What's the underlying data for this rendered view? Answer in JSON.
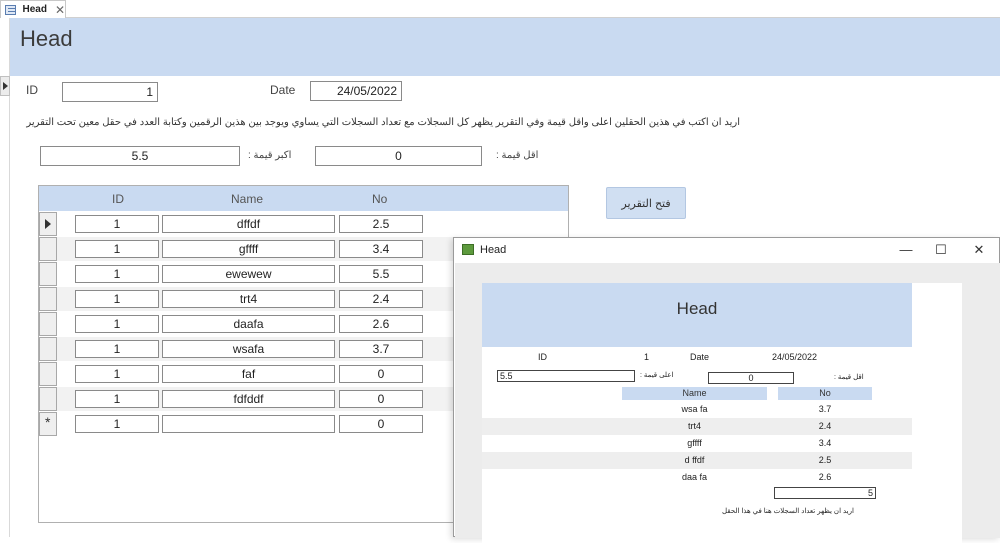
{
  "tab": {
    "label": "Head",
    "close": "✕"
  },
  "form": {
    "title": "Head",
    "id_label": "ID",
    "id_value": "1",
    "date_label": "Date",
    "date_value": "24/05/2022",
    "instruction": "اريد ان اكتب في هذين الحقلين اعلى واقل قيمة وفي التقرير يظهر كل السجلات مع تعداد السجلات التي يساوي ويوجد بين هذين الرقمين  وكتابة العدد في حقل معين تحت التقرير",
    "max_label": "اكبر قيمة :",
    "max_value": "5.5",
    "min_label": "اقل قيمة :",
    "min_value": "0",
    "open_report_button": "فتح التقرير"
  },
  "subform": {
    "columns": [
      "ID",
      "Name",
      "No"
    ],
    "rows": [
      {
        "id": "1",
        "name": "dffdf",
        "no": "2.5"
      },
      {
        "id": "1",
        "name": "gffff",
        "no": "3.4"
      },
      {
        "id": "1",
        "name": "ewewew",
        "no": "5.5"
      },
      {
        "id": "1",
        "name": "trt4",
        "no": "2.4"
      },
      {
        "id": "1",
        "name": "daafa",
        "no": "2.6"
      },
      {
        "id": "1",
        "name": "wsafa",
        "no": "3.7"
      },
      {
        "id": "1",
        "name": "faf",
        "no": "0"
      },
      {
        "id": "1",
        "name": "fdfddf",
        "no": "0"
      }
    ],
    "new_row": {
      "id": "1",
      "name": "",
      "no": "0"
    }
  },
  "report_window": {
    "title": "Head",
    "minimize": "—",
    "maximize": "☐",
    "close": "✕",
    "report_title": "Head",
    "id_label": "ID",
    "id_value": "1",
    "date_label": "Date",
    "date_value": "24/05/2022",
    "max_label": "اعلى قيمة :",
    "max_value": "5.5",
    "min_label": "اقل قيمة :",
    "min_value": "0",
    "col_name": "Name",
    "col_no": "No",
    "rows": [
      {
        "name": "wsa fa",
        "no": "3.7"
      },
      {
        "name": "trt4",
        "no": "2.4"
      },
      {
        "name": "gffff",
        "no": "3.4"
      },
      {
        "name": "d ffdf",
        "no": "2.5"
      },
      {
        "name": "daa fa",
        "no": "2.6"
      }
    ],
    "count_value": "5",
    "count_caption": "اريد ان يظهر تعداد السجلات هنا في هذا الحقل"
  }
}
